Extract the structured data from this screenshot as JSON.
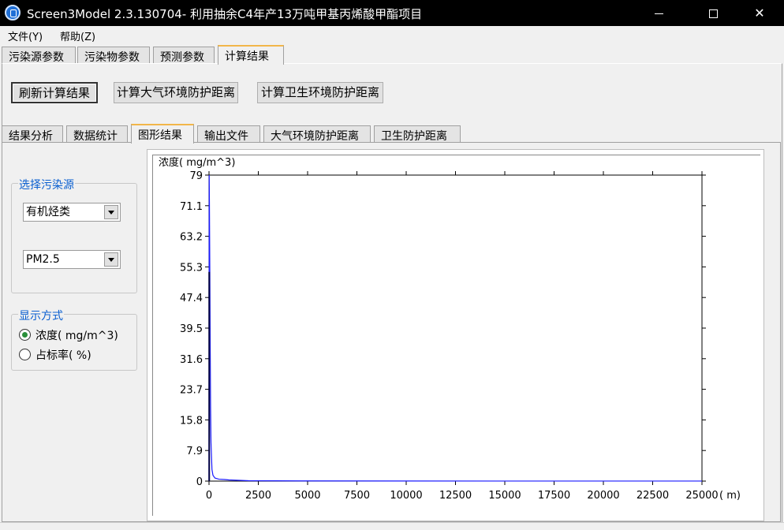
{
  "window": {
    "title": "Screen3Model 2.3.130704- 利用抽余C4年产13万吨甲基丙烯酸甲酯项目"
  },
  "menu": {
    "items": [
      "文件(Y)",
      "帮助(Z)"
    ]
  },
  "top_tabs": [
    "污染源参数",
    "污染物参数",
    "预测参数",
    "计算结果"
  ],
  "buttons": {
    "refresh": "刷新计算结果",
    "atm_distance": "计算大气环境防护距离",
    "health_distance": "计算卫生环境防护距离"
  },
  "sub_tabs": [
    "结果分析",
    "数据统计",
    "图形结果",
    "输出文件",
    "大气环境防护距离",
    "卫生防护距离"
  ],
  "source_group": {
    "legend": "选择污染源",
    "source_value": "有机烃类",
    "pollutant_value": "PM2.5"
  },
  "display_group": {
    "legend": "显示方式",
    "options": [
      "浓度( mg/m^3)",
      "占标率( %)"
    ],
    "selected": 0
  },
  "colors": {
    "accent_tab": "#f2b64a",
    "series": "#1a1aff",
    "legend_text": "#0a5fd0"
  },
  "chart_data": {
    "type": "line",
    "ylabel": "浓度( mg/m^3)",
    "xlabel": "( m)",
    "xlim": [
      0,
      25000
    ],
    "ylim": [
      0,
      79
    ],
    "x_ticks": [
      0,
      2500,
      5000,
      7500,
      10000,
      12500,
      15000,
      17500,
      20000,
      22500,
      25000
    ],
    "x_tick_labels": [
      "0",
      "2500",
      "5000",
      "7500",
      "10000",
      "12500",
      "15000",
      "17500",
      "20000",
      "22500",
      "25000"
    ],
    "y_ticks": [
      0,
      7.9,
      15.8,
      23.7,
      31.6,
      39.5,
      47.4,
      55.3,
      63.2,
      71.1,
      79
    ],
    "y_tick_labels": [
      "0",
      "7.9",
      "15.8",
      "23.7",
      "31.6",
      "39.5",
      "47.4",
      "55.3",
      "63.2",
      "71.1",
      "79"
    ],
    "grid": false,
    "x": [
      0,
      10,
      20,
      40,
      60,
      80,
      100,
      150,
      200,
      300,
      500,
      800,
      1000,
      2000,
      5000,
      10000,
      25000
    ],
    "series": [
      {
        "values": [
          0,
          79,
          72,
          55,
          35,
          19,
          10,
          3,
          1.5,
          0.8,
          0.5,
          0.4,
          0.3,
          0.1,
          0.05,
          0.02,
          0.01
        ]
      }
    ],
    "peak_bar": {
      "x": 10,
      "y": 54
    }
  }
}
